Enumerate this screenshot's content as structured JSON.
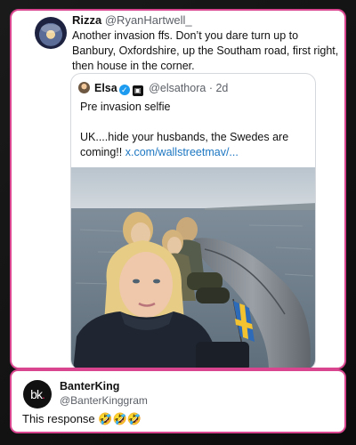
{
  "tweet": {
    "author_name": "Rizza",
    "author_handle": "@RyanHartwell_",
    "text": "Another invasion ffs. Don’t you dare turn up to Banbury, Oxfordshire, up the Southam road, first right, then house in the corner."
  },
  "quoted_tweet": {
    "author_name": "Elsa",
    "author_handle": "@elsathora",
    "separator": "·",
    "time": "2d",
    "verified_icon": "verified-check-icon",
    "affiliation_icon": "affiliate-badge-icon",
    "line1": "Pre invasion selfie",
    "line2": "UK....hide your husbands, the Swedes are coming!!",
    "link": "x.com/wallstreetmav/..."
  },
  "reply": {
    "logo_text": "bk",
    "logo_dot": ".",
    "author_name": "BanterKing",
    "author_handle": "@BanterKinggram",
    "text": "This response 🤣🤣🤣"
  },
  "colors": {
    "accent_border": "#d9468f",
    "link": "#1d77c2",
    "verified": "#1d9bf0"
  }
}
